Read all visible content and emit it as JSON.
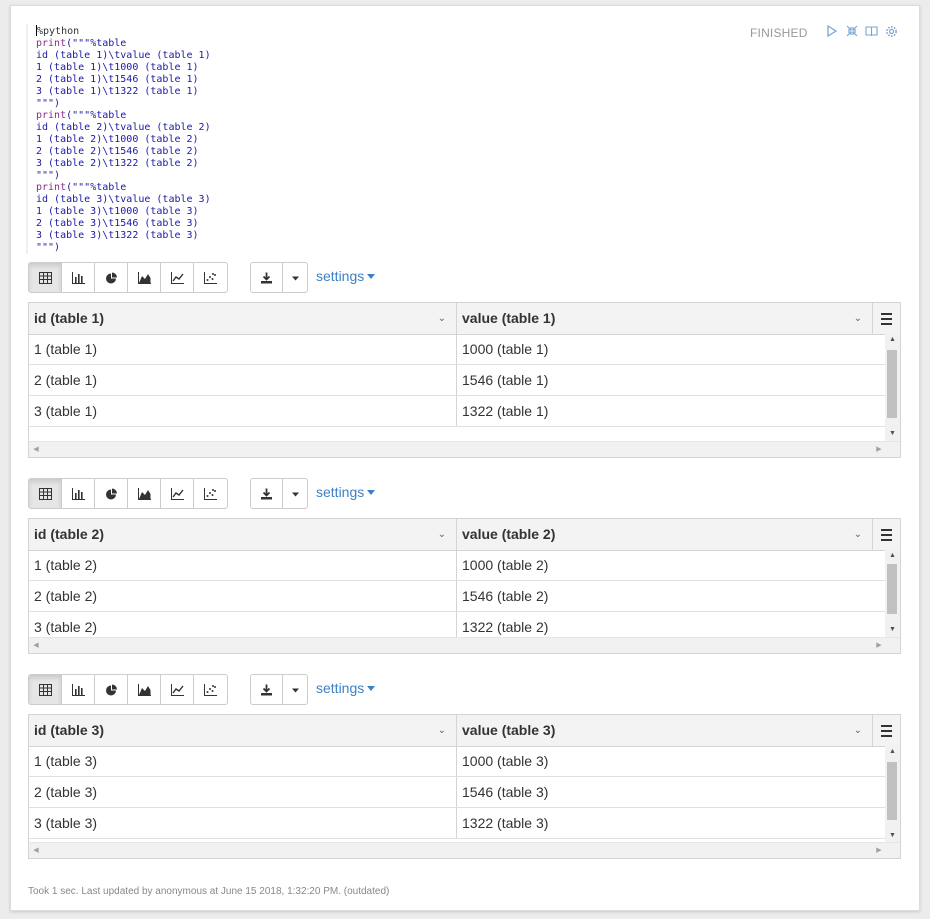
{
  "paragraph": {
    "code_lines": [
      "%python",
      "print(\"\"\"%table",
      "id (table 1)\\tvalue (table 1)",
      "1 (table 1)\\t1000 (table 1)",
      "2 (table 1)\\t1546 (table 1)",
      "3 (table 1)\\t1322 (table 1)",
      "\"\"\")",
      "print(\"\"\"%table",
      "id (table 2)\\tvalue (table 2)",
      "1 (table 2)\\t1000 (table 2)",
      "2 (table 2)\\t1546 (table 2)",
      "3 (table 2)\\t1322 (table 2)",
      "\"\"\")",
      "print(\"\"\"%table",
      "id (table 3)\\tvalue (table 3)",
      "1 (table 3)\\t1000 (table 3)",
      "2 (table 3)\\t1546 (table 3)",
      "3 (table 3)\\t1322 (table 3)",
      "\"\"\")"
    ],
    "status": "FINISHED",
    "footer": "Took 1 sec. Last updated by anonymous at June 15 2018, 1:32:20 PM. (outdated)"
  },
  "toolbar": {
    "settings_label": "settings",
    "icons": [
      "table-icon",
      "bar-chart-icon",
      "pie-chart-icon",
      "area-chart-icon",
      "line-chart-icon",
      "scatter-chart-icon"
    ]
  },
  "tables": [
    {
      "headers": [
        "id (table 1)",
        "value (table 1)"
      ],
      "rows": [
        [
          "1 (table 1)",
          "1000 (table 1)"
        ],
        [
          "2 (table 1)",
          "1546 (table 1)"
        ],
        [
          "3 (table 1)",
          "1322 (table 1)"
        ]
      ]
    },
    {
      "headers": [
        "id (table 2)",
        "value (table 2)"
      ],
      "rows": [
        [
          "1 (table 2)",
          "1000 (table 2)"
        ],
        [
          "2 (table 2)",
          "1546 (table 2)"
        ],
        [
          "3 (table 2)",
          "1322 (table 2)"
        ]
      ]
    },
    {
      "headers": [
        "id (table 3)",
        "value (table 3)"
      ],
      "rows": [
        [
          "1 (table 3)",
          "1000 (table 3)"
        ],
        [
          "2 (table 3)",
          "1546 (table 3)"
        ],
        [
          "3 (table 3)",
          "1322 (table 3)"
        ]
      ]
    }
  ]
}
